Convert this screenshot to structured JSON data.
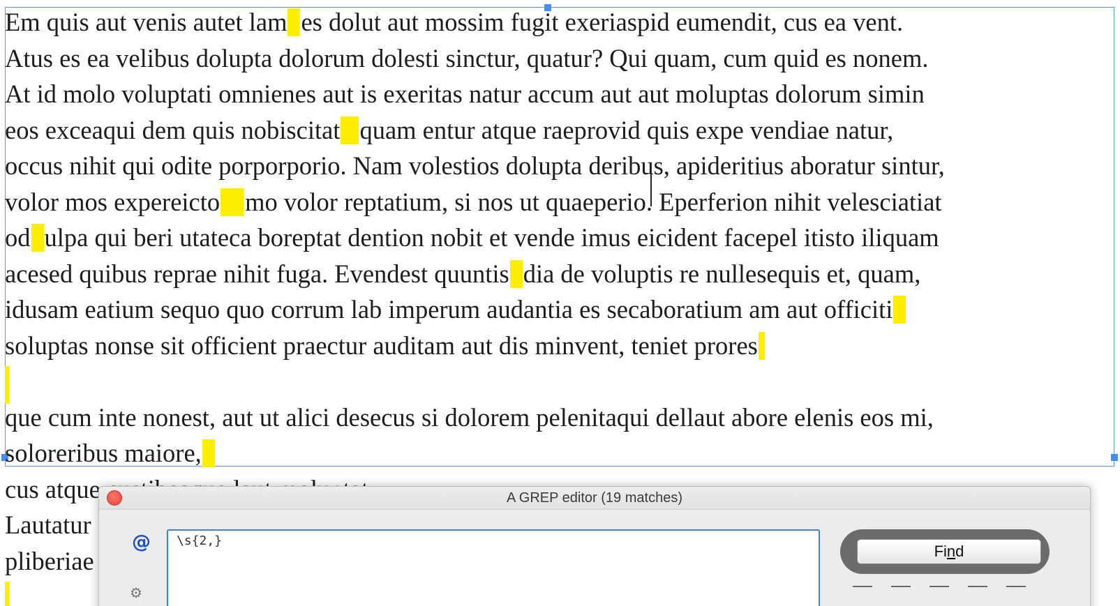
{
  "document": {
    "lines": [
      {
        "segments": [
          "Em quis aut venis autet lam",
          "es dolut aut mossim fugit exeriaspid eumendit, cus ea vent."
        ]
      },
      {
        "segments": [
          "Atus es ea velibus dolupta dolorum dolesti sinctur, quatur? Qui quam, cum quid es nonem."
        ]
      },
      {
        "segments": [
          "At id molo voluptati omnienes aut is exeritas natur accum aut aut moluptas dolorum simin"
        ]
      },
      {
        "segments": [
          "eos exceaqui dem quis nobiscitat",
          "quam entur atque raeprovid quis expe vendiae natur,"
        ]
      },
      {
        "segments": [
          "occus nihit qui odite porporporio. Nam volestios dolupta deribus, apideritius aboratur sintur,"
        ]
      },
      {
        "segments": [
          "volor mos expereicto",
          "mo volor reptatium, si nos ut quaeperio. Eperferion nihit velesciatiat"
        ]
      },
      {
        "segments": [
          "od",
          "ulpa qui beri utateca boreptat dention nobit et vende imus eicident facepel itisto iliquam"
        ]
      },
      {
        "segments": [
          "acesed quibus reprae nihit fuga. Evendest quuntis",
          "dia de voluptis re nullesequis et, quam,"
        ]
      },
      {
        "segments": [
          "idusam eatium sequo quo corrum lab imperum audantia es secaboratium am aut officiti",
          ""
        ]
      },
      {
        "segments": [
          "soluptas nonse sit officient praectur auditam aut dis minvent, teniet prores",
          ""
        ]
      },
      {
        "segments": [
          ""
        ]
      },
      {
        "segments": [
          "que cum inte nonest, aut ut alici desecus si dolorem pelenitaqui dellaut abore elenis eos mi,"
        ]
      },
      {
        "segments": [
          "soloreribus maiore,",
          ""
        ]
      },
      {
        "segments": [
          "cus atque custibeaque laut moluptat."
        ]
      },
      {
        "segments": [
          "Lautatur"
        ]
      },
      {
        "segments": [
          "pliberiae"
        ]
      },
      {
        "segments": [
          ""
        ]
      }
    ],
    "highlight_color": "#ffee00"
  },
  "grep_editor": {
    "title": "A GREP editor (19 matches)",
    "query": "\\s{2,}",
    "find_label_pre": "Fi",
    "find_label_u": "n",
    "find_label_post": "d",
    "accent_color": "#3f7ee8"
  }
}
